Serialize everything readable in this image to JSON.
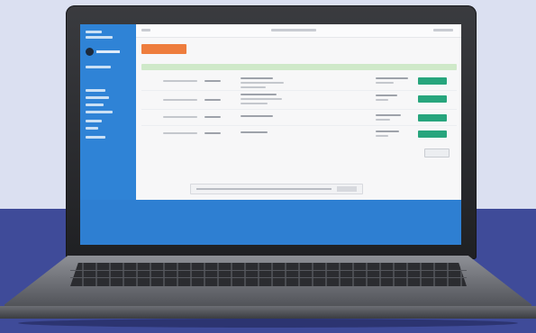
{
  "scene": {
    "background_top_color": "#dbe0f1",
    "background_bottom_color": "#3f4b99",
    "device": "laptop"
  },
  "app": {
    "accent_color": "#2f83d6",
    "primary_action_color": "#ee7d3d",
    "status_color": "#27a57d",
    "table_header_color": "#cfe9c9"
  },
  "sidebar": {
    "items": [
      "",
      "",
      "",
      "",
      "",
      "",
      "",
      ""
    ]
  },
  "table": {
    "rows": [
      {
        "status": "button"
      },
      {
        "status": "button"
      },
      {
        "status": "button"
      },
      {
        "status": "button"
      }
    ]
  }
}
